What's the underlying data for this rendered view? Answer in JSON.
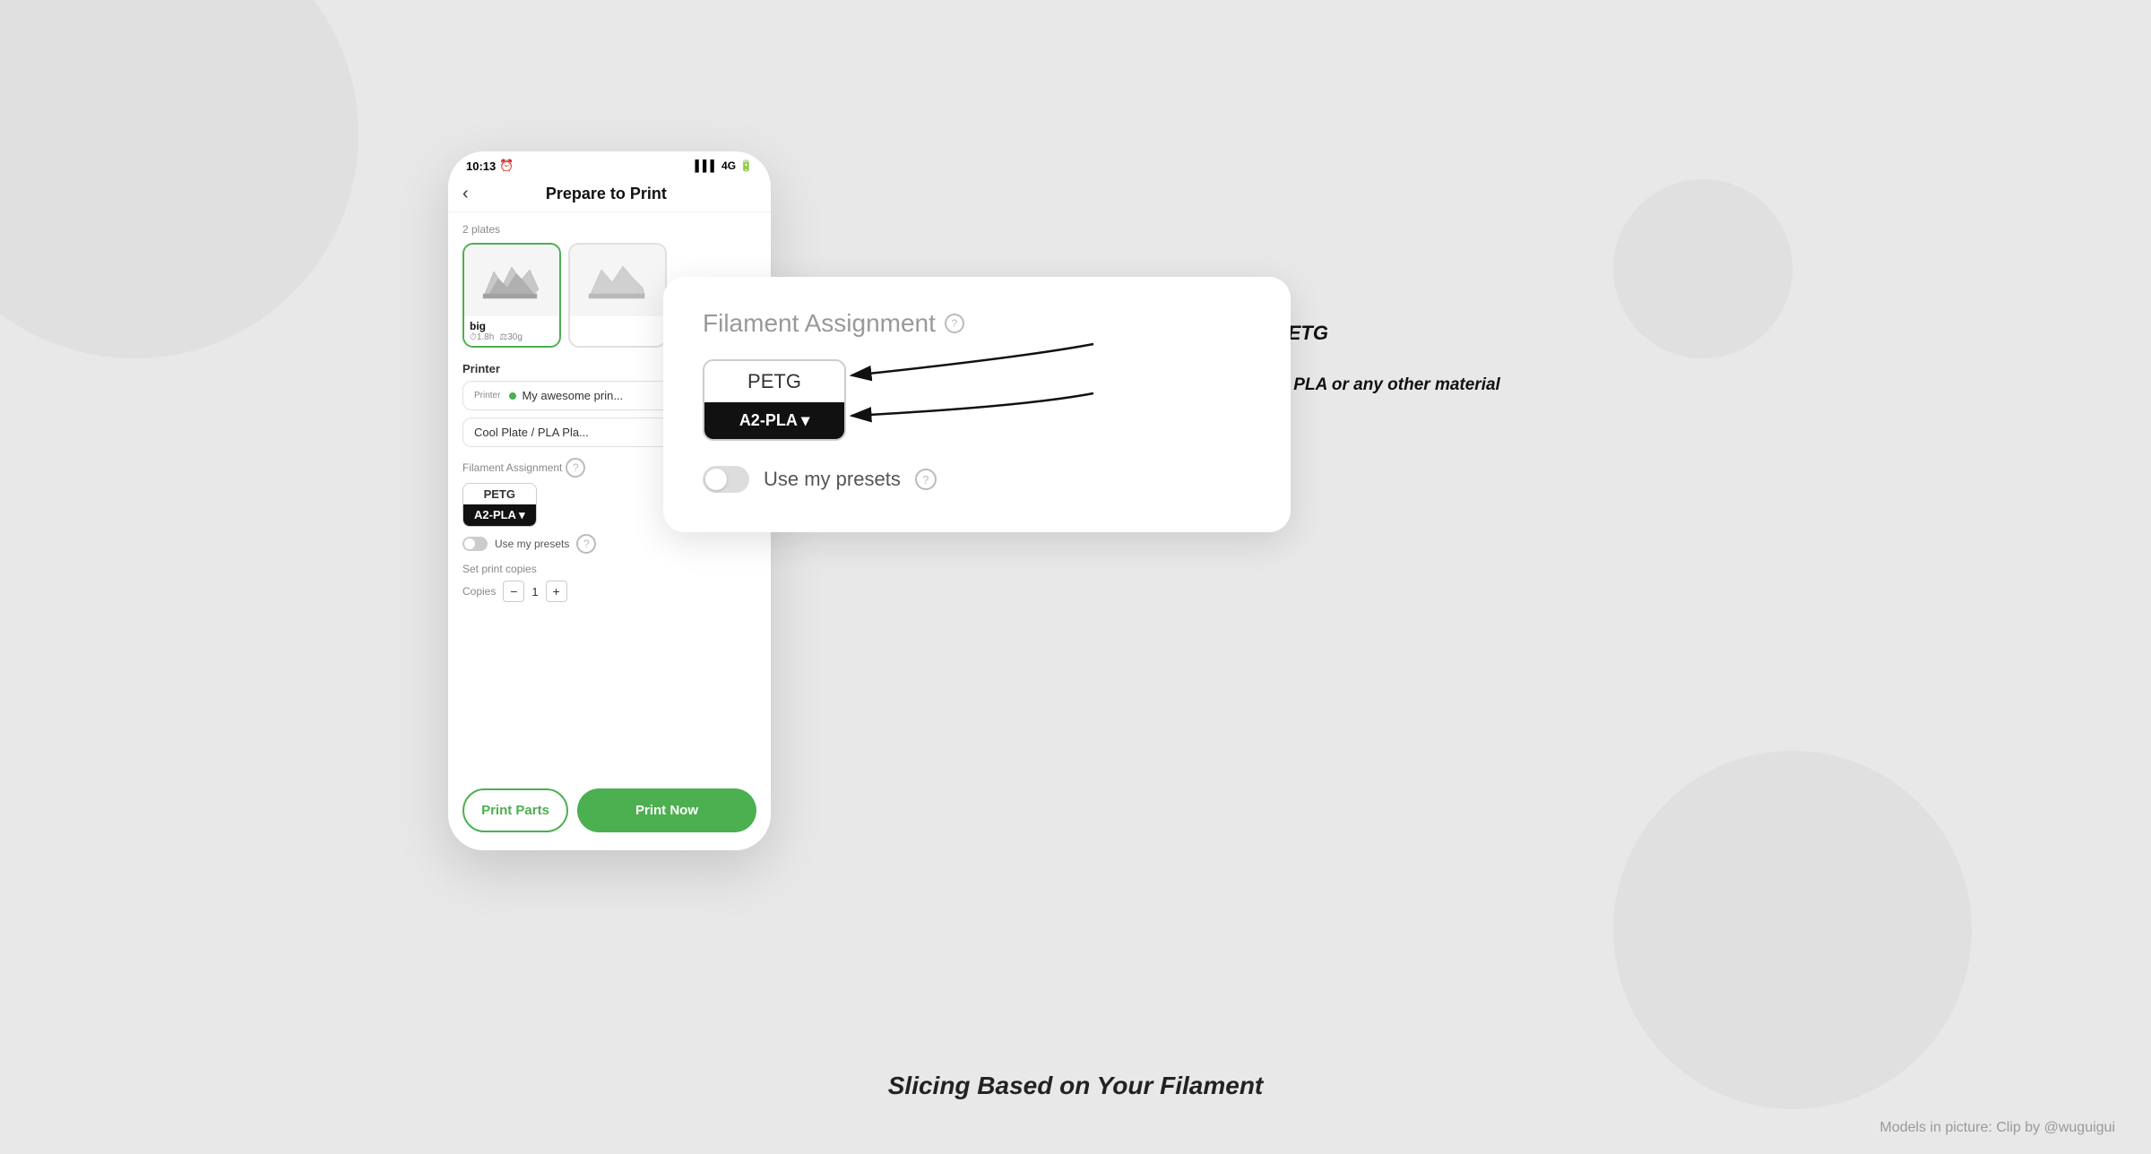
{
  "background": {
    "color": "#e8e8e8"
  },
  "statusBar": {
    "time": "10:13",
    "signal": "4G",
    "batteryIcon": "battery"
  },
  "phoneHeader": {
    "backLabel": "‹",
    "title": "Prepare to Print"
  },
  "platesSection": {
    "label": "2 plates",
    "plates": [
      {
        "name": "big",
        "time": "1.8h",
        "weight": "30g",
        "active": true
      },
      {
        "name": "",
        "time": "",
        "weight": "",
        "active": false
      }
    ]
  },
  "printerSection": {
    "label": "Printer",
    "printerLabel": "Printer",
    "printerName": "My awesome prin...",
    "plateName": "Cool Plate / PLA Pla..."
  },
  "filamentSection": {
    "label": "Filament Assignment",
    "helpIcon": "?",
    "petgLabel": "PETG",
    "a2plaLabel": "A2-PLA ▾"
  },
  "presetsSection": {
    "label": "Use my presets",
    "helpIcon": "?"
  },
  "copiesSection": {
    "label": "Set print copies",
    "helpIcon": "?",
    "copiesLabel": "Copies",
    "quantity": "1",
    "minusLabel": "−",
    "plusLabel": "+"
  },
  "bottomButtons": {
    "printPartsLabel": "Print Parts",
    "printNowLabel": "Print Now"
  },
  "popup": {
    "title": "Filament Assignment",
    "helpIcon": "?",
    "petgLabel": "PETG",
    "a2plaLabel": "A2-PLA ▾",
    "presetsLabel": "Use my presets",
    "presetsHelpIcon": "?"
  },
  "annotations": {
    "arrow1Text": "Print Profile uses PETG",
    "arrow2Text": "You could change it to PLA or any other material"
  },
  "bottomText": "Slicing Based on Your Filament",
  "attribution": "Models in picture: Clip by @wuguigui"
}
